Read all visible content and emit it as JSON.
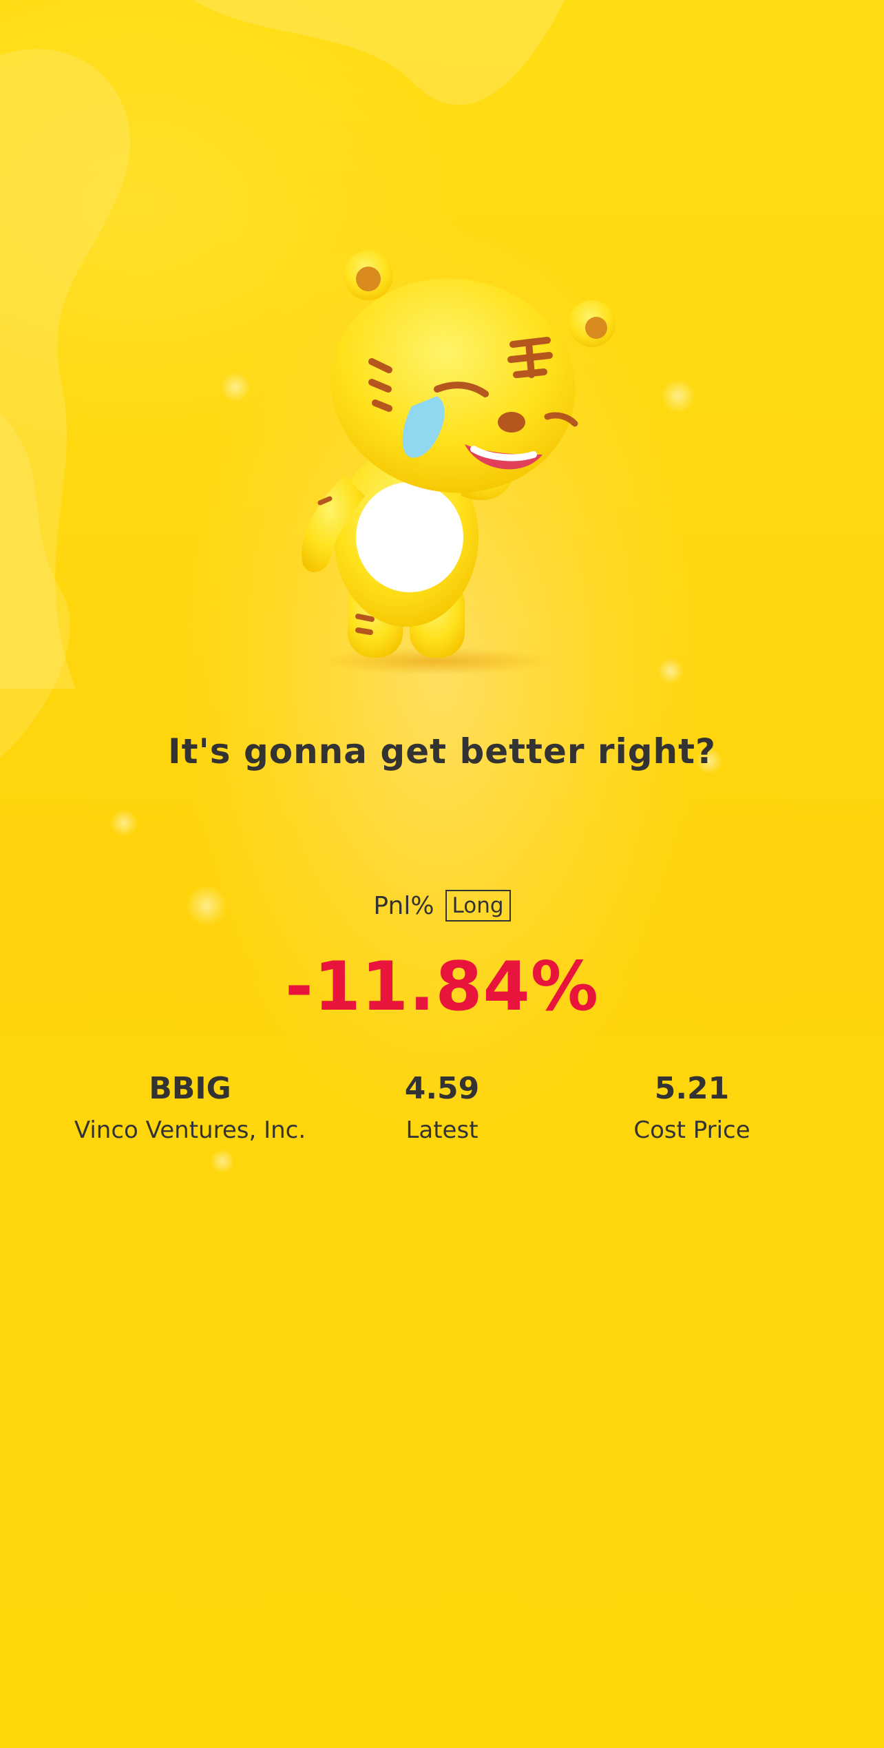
{
  "headline": "It's gonna get better right?",
  "pnl": {
    "label": "Pnl%",
    "position_tag": "Long",
    "value": "-11.84%",
    "value_color": "#E8143C"
  },
  "stats": [
    {
      "value": "BBIG",
      "label": "Vinco Ventures, Inc."
    },
    {
      "value": "4.59",
      "label": "Latest"
    },
    {
      "value": "5.21",
      "label": "Cost Price"
    }
  ],
  "mascot": {
    "icon": "crying-tiger-mascot-icon"
  },
  "colors": {
    "background": "#FFD80A",
    "text": "#333333",
    "loss": "#E8143C"
  }
}
